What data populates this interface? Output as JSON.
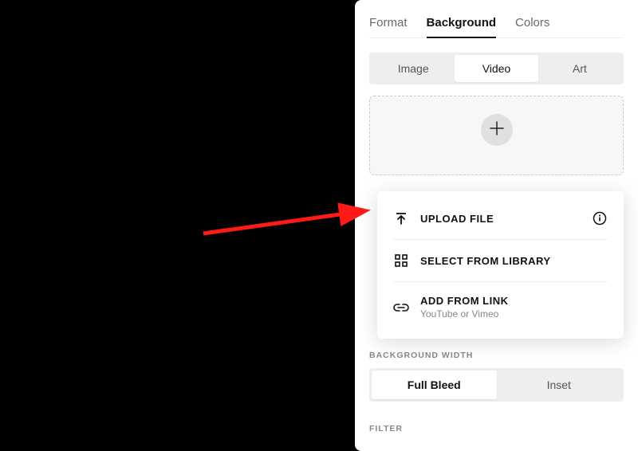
{
  "tabs": {
    "format": "Format",
    "background": "Background",
    "colors": "Colors",
    "active": "background"
  },
  "media_type": {
    "image": "Image",
    "video": "Video",
    "art": "Art",
    "active": "video"
  },
  "dropzone": {
    "plus_label": "+"
  },
  "popup": {
    "upload": {
      "label": "UPLOAD FILE"
    },
    "library": {
      "label": "SELECT FROM LIBRARY"
    },
    "link": {
      "label": "ADD FROM LINK",
      "sublabel": "YouTube or Vimeo"
    }
  },
  "background_width": {
    "label": "BACKGROUND WIDTH",
    "full_bleed": "Full Bleed",
    "inset": "Inset",
    "active": "full_bleed"
  },
  "filter": {
    "label": "FILTER"
  },
  "annotation": {
    "arrow_color": "#ff1a1a"
  }
}
